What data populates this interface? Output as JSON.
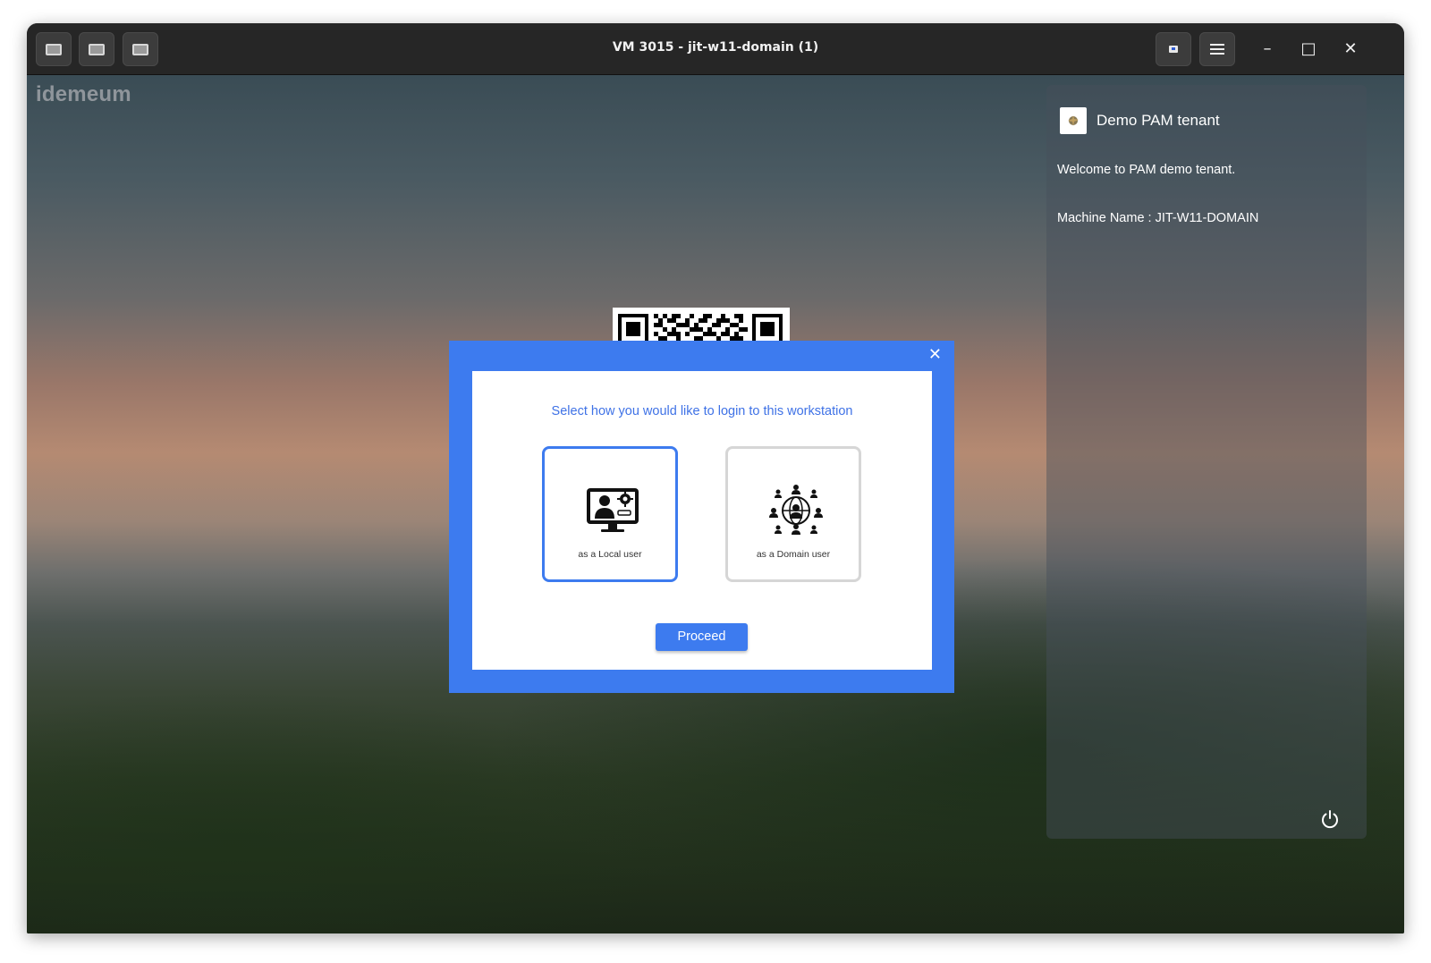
{
  "window": {
    "title": "VM 3015 - jit-w11-domain (1)",
    "left_buttons": [
      "screen-icon",
      "screen-icon",
      "screen-icon"
    ],
    "controls": {
      "minimize": "–",
      "maximize": "□",
      "close": "✕"
    }
  },
  "desktop": {
    "brand": "idemeum"
  },
  "side_panel": {
    "tenant_name": "Demo PAM tenant",
    "welcome": "Welcome to PAM demo tenant.",
    "machine_name": "Machine Name : JIT-W11-DOMAIN"
  },
  "dialog": {
    "close_symbol": "✕",
    "heading": "Select how you would like to login to this workstation",
    "options": [
      {
        "label": "as a Local user",
        "selected": true,
        "icon": "local-user-computer-icon"
      },
      {
        "label": "as a Domain user",
        "selected": false,
        "icon": "domain-users-network-icon"
      }
    ],
    "proceed_label": "Proceed"
  },
  "colors": {
    "accent": "#3d7bef",
    "heading": "#3f72e6",
    "titlebar": "#262626"
  }
}
